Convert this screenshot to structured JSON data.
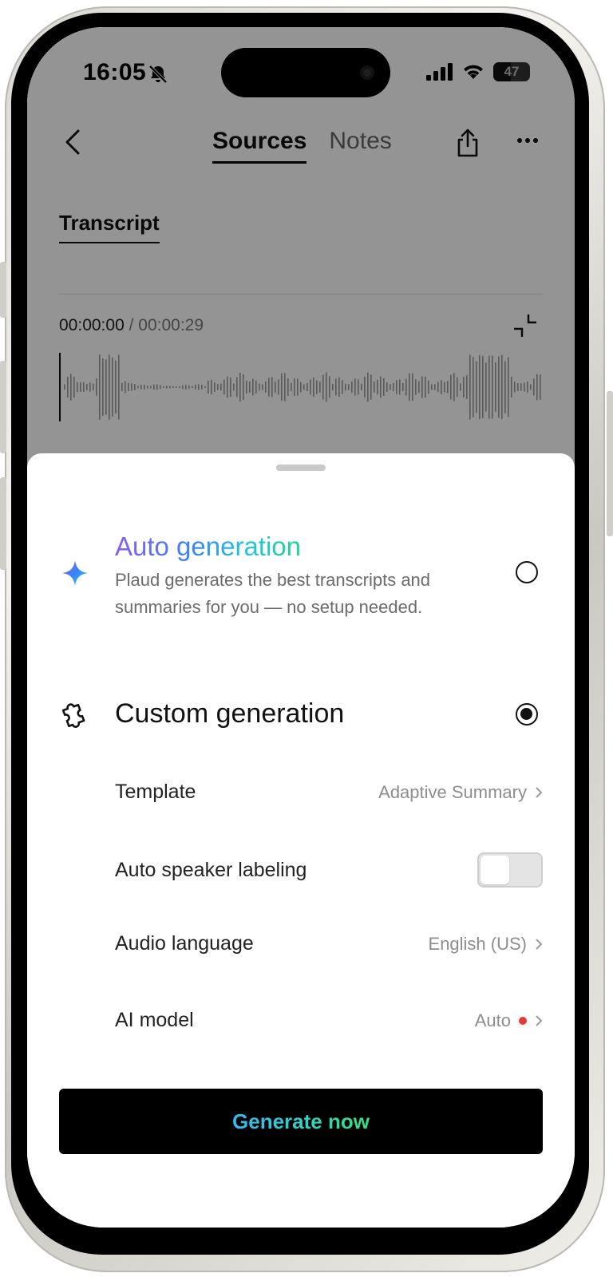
{
  "status_bar": {
    "time": "16:05",
    "battery": "47"
  },
  "nav": {
    "tabs": [
      {
        "label": "Sources",
        "active": true
      },
      {
        "label": "Notes",
        "active": false
      }
    ]
  },
  "transcript": {
    "tab_label": "Transcript",
    "current_time": "00:00:00",
    "separator": " / ",
    "total_time": "00:00:29"
  },
  "sheet": {
    "auto": {
      "title": "Auto generation",
      "description": "Plaud generates the best transcripts and summaries for you — no setup needed.",
      "selected": false
    },
    "custom": {
      "title": "Custom generation",
      "selected": true
    },
    "settings": {
      "template_label": "Template",
      "template_value": "Adaptive Summary",
      "speaker_label": "Auto speaker labeling",
      "speaker_enabled": false,
      "language_label": "Audio language",
      "language_value": "English (US)",
      "model_label": "AI model",
      "model_value": "Auto"
    },
    "generate_label": "Generate now"
  },
  "colors": {
    "accent_gradient_start": "#8a5cf6",
    "accent_gradient_end": "#1ed48f",
    "model_dot": "#e53935"
  }
}
